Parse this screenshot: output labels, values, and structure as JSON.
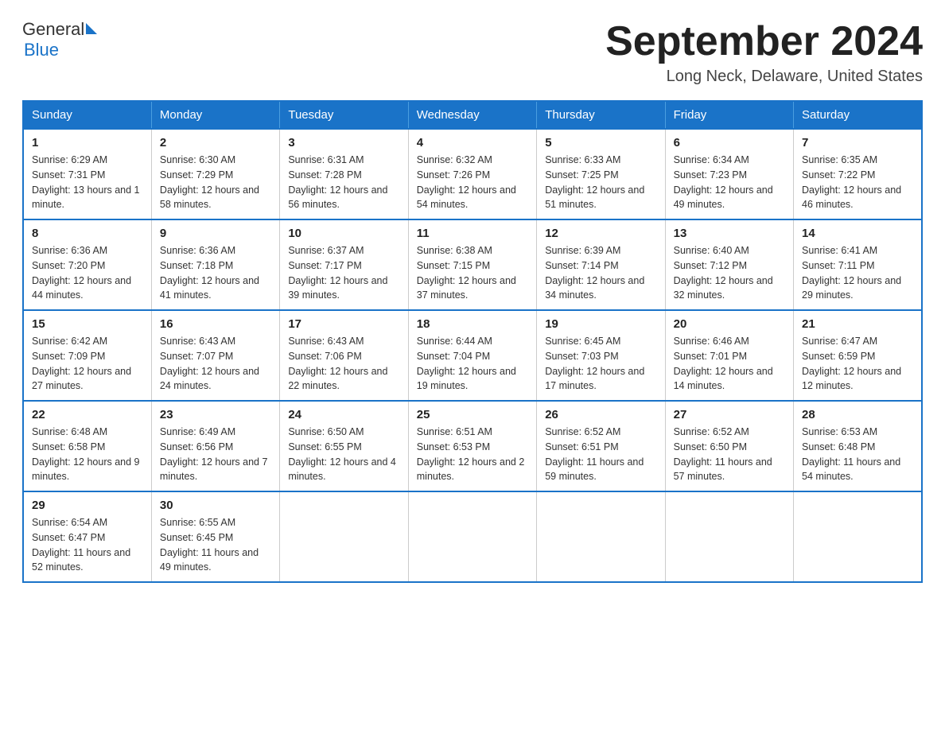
{
  "logo": {
    "general": "General",
    "triangle": "",
    "blue": "Blue"
  },
  "title": "September 2024",
  "location": "Long Neck, Delaware, United States",
  "days_of_week": [
    "Sunday",
    "Monday",
    "Tuesday",
    "Wednesday",
    "Thursday",
    "Friday",
    "Saturday"
  ],
  "weeks": [
    [
      {
        "day": "1",
        "sunrise": "6:29 AM",
        "sunset": "7:31 PM",
        "daylight": "13 hours and 1 minute."
      },
      {
        "day": "2",
        "sunrise": "6:30 AM",
        "sunset": "7:29 PM",
        "daylight": "12 hours and 58 minutes."
      },
      {
        "day": "3",
        "sunrise": "6:31 AM",
        "sunset": "7:28 PM",
        "daylight": "12 hours and 56 minutes."
      },
      {
        "day": "4",
        "sunrise": "6:32 AM",
        "sunset": "7:26 PM",
        "daylight": "12 hours and 54 minutes."
      },
      {
        "day": "5",
        "sunrise": "6:33 AM",
        "sunset": "7:25 PM",
        "daylight": "12 hours and 51 minutes."
      },
      {
        "day": "6",
        "sunrise": "6:34 AM",
        "sunset": "7:23 PM",
        "daylight": "12 hours and 49 minutes."
      },
      {
        "day": "7",
        "sunrise": "6:35 AM",
        "sunset": "7:22 PM",
        "daylight": "12 hours and 46 minutes."
      }
    ],
    [
      {
        "day": "8",
        "sunrise": "6:36 AM",
        "sunset": "7:20 PM",
        "daylight": "12 hours and 44 minutes."
      },
      {
        "day": "9",
        "sunrise": "6:36 AM",
        "sunset": "7:18 PM",
        "daylight": "12 hours and 41 minutes."
      },
      {
        "day": "10",
        "sunrise": "6:37 AM",
        "sunset": "7:17 PM",
        "daylight": "12 hours and 39 minutes."
      },
      {
        "day": "11",
        "sunrise": "6:38 AM",
        "sunset": "7:15 PM",
        "daylight": "12 hours and 37 minutes."
      },
      {
        "day": "12",
        "sunrise": "6:39 AM",
        "sunset": "7:14 PM",
        "daylight": "12 hours and 34 minutes."
      },
      {
        "day": "13",
        "sunrise": "6:40 AM",
        "sunset": "7:12 PM",
        "daylight": "12 hours and 32 minutes."
      },
      {
        "day": "14",
        "sunrise": "6:41 AM",
        "sunset": "7:11 PM",
        "daylight": "12 hours and 29 minutes."
      }
    ],
    [
      {
        "day": "15",
        "sunrise": "6:42 AM",
        "sunset": "7:09 PM",
        "daylight": "12 hours and 27 minutes."
      },
      {
        "day": "16",
        "sunrise": "6:43 AM",
        "sunset": "7:07 PM",
        "daylight": "12 hours and 24 minutes."
      },
      {
        "day": "17",
        "sunrise": "6:43 AM",
        "sunset": "7:06 PM",
        "daylight": "12 hours and 22 minutes."
      },
      {
        "day": "18",
        "sunrise": "6:44 AM",
        "sunset": "7:04 PM",
        "daylight": "12 hours and 19 minutes."
      },
      {
        "day": "19",
        "sunrise": "6:45 AM",
        "sunset": "7:03 PM",
        "daylight": "12 hours and 17 minutes."
      },
      {
        "day": "20",
        "sunrise": "6:46 AM",
        "sunset": "7:01 PM",
        "daylight": "12 hours and 14 minutes."
      },
      {
        "day": "21",
        "sunrise": "6:47 AM",
        "sunset": "6:59 PM",
        "daylight": "12 hours and 12 minutes."
      }
    ],
    [
      {
        "day": "22",
        "sunrise": "6:48 AM",
        "sunset": "6:58 PM",
        "daylight": "12 hours and 9 minutes."
      },
      {
        "day": "23",
        "sunrise": "6:49 AM",
        "sunset": "6:56 PM",
        "daylight": "12 hours and 7 minutes."
      },
      {
        "day": "24",
        "sunrise": "6:50 AM",
        "sunset": "6:55 PM",
        "daylight": "12 hours and 4 minutes."
      },
      {
        "day": "25",
        "sunrise": "6:51 AM",
        "sunset": "6:53 PM",
        "daylight": "12 hours and 2 minutes."
      },
      {
        "day": "26",
        "sunrise": "6:52 AM",
        "sunset": "6:51 PM",
        "daylight": "11 hours and 59 minutes."
      },
      {
        "day": "27",
        "sunrise": "6:52 AM",
        "sunset": "6:50 PM",
        "daylight": "11 hours and 57 minutes."
      },
      {
        "day": "28",
        "sunrise": "6:53 AM",
        "sunset": "6:48 PM",
        "daylight": "11 hours and 54 minutes."
      }
    ],
    [
      {
        "day": "29",
        "sunrise": "6:54 AM",
        "sunset": "6:47 PM",
        "daylight": "11 hours and 52 minutes."
      },
      {
        "day": "30",
        "sunrise": "6:55 AM",
        "sunset": "6:45 PM",
        "daylight": "11 hours and 49 minutes."
      },
      null,
      null,
      null,
      null,
      null
    ]
  ]
}
